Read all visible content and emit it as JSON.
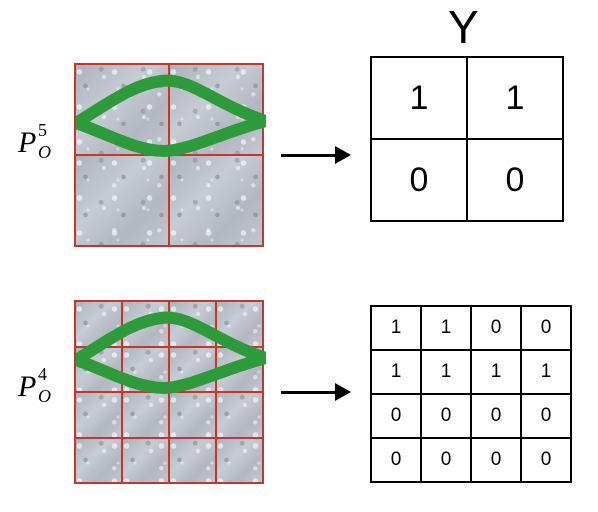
{
  "labels": {
    "Y": "Y",
    "P5": {
      "base": "P",
      "sub": "O",
      "sup": "5"
    },
    "P4": {
      "base": "P",
      "sub": "O",
      "sup": "4"
    }
  },
  "top_output": {
    "rows": 2,
    "cols": 2,
    "cells": [
      [
        "1",
        "1"
      ],
      [
        "0",
        "0"
      ]
    ]
  },
  "bottom_output": {
    "rows": 4,
    "cols": 4,
    "cells": [
      [
        "1",
        "1",
        "0",
        "0"
      ],
      [
        "1",
        "1",
        "1",
        "1"
      ],
      [
        "0",
        "0",
        "0",
        "0"
      ],
      [
        "0",
        "0",
        "0",
        "0"
      ]
    ]
  },
  "chart_data": {
    "type": "diagram",
    "description": "Two resolutions of a feature map / image patch with a green road-like path. Each is mapped (arrow) to a binary occupancy grid Y. P_O^5 yields a 2x2 grid, P_O^4 yields a 4x4 grid. Cells containing the green path are 1, others 0.",
    "levels": [
      {
        "name": "P_O^5",
        "grid": [
          [
            1,
            1
          ],
          [
            0,
            0
          ]
        ]
      },
      {
        "name": "P_O^4",
        "grid": [
          [
            1,
            1,
            0,
            0
          ],
          [
            1,
            1,
            1,
            1
          ],
          [
            0,
            0,
            0,
            0
          ],
          [
            0,
            0,
            0,
            0
          ]
        ]
      }
    ]
  }
}
